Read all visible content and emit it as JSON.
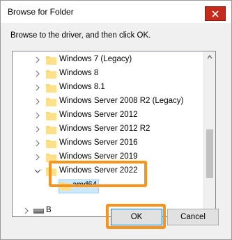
{
  "dialog": {
    "title": "Browse for Folder",
    "instruction": "Browse to the driver, and then click OK."
  },
  "tree": {
    "items": [
      {
        "label": "Windows 7 (Legacy)",
        "expanded": false
      },
      {
        "label": "Windows 8",
        "expanded": false
      },
      {
        "label": "Windows 8.1",
        "expanded": false
      },
      {
        "label": "Windows Server 2008 R2 (Legacy)",
        "expanded": false
      },
      {
        "label": "Windows Server 2012",
        "expanded": false
      },
      {
        "label": "Windows Server 2012 R2",
        "expanded": false
      },
      {
        "label": "Windows Server 2016",
        "expanded": false
      },
      {
        "label": "Windows Server 2019",
        "expanded": false
      },
      {
        "label": "Windows Server 2022",
        "expanded": true
      }
    ],
    "child": {
      "label": "amd64",
      "selected": true
    },
    "drive": {
      "label": "B"
    }
  },
  "buttons": {
    "ok": "OK",
    "cancel": "Cancel"
  },
  "colors": {
    "highlight": "#f7941d",
    "close": "#c42b1c",
    "selection": "#cce8ff"
  }
}
